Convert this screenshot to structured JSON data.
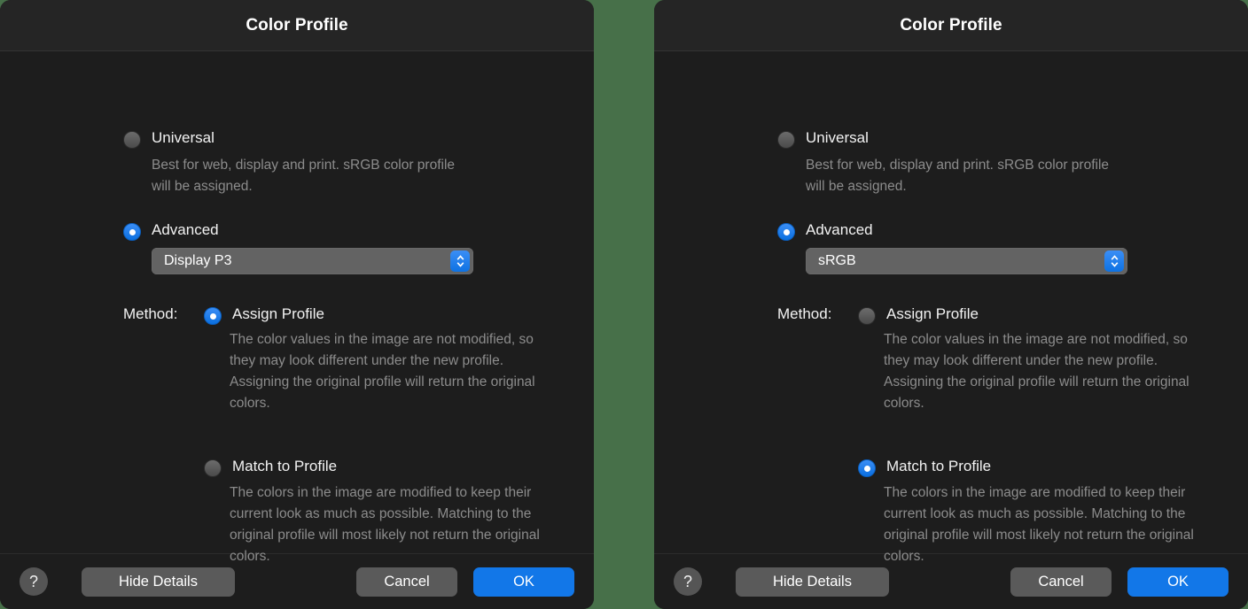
{
  "background_color": "#477049",
  "accent_color": "#1277e8",
  "dialogs": [
    {
      "title": "Color Profile",
      "universal": {
        "label": "Universal",
        "selected": false,
        "description": "Best for web, display and print. sRGB color profile will be assigned."
      },
      "advanced": {
        "label": "Advanced",
        "selected": true,
        "profile_value": "Display P3"
      },
      "method": {
        "label": "Method:",
        "assign": {
          "label": "Assign Profile",
          "selected": true,
          "description": "The color values in the image are not modified, so they may look different under the new profile. Assigning the original profile will return the original colors."
        },
        "match": {
          "label": "Match to Profile",
          "selected": false,
          "description": "The colors in the image are modified to keep their current look as much as possible. Matching to the original profile will most likely not return the original colors."
        }
      },
      "footer": {
        "help_label": "?",
        "hide_details_label": "Hide Details",
        "cancel_label": "Cancel",
        "ok_label": "OK"
      }
    },
    {
      "title": "Color Profile",
      "universal": {
        "label": "Universal",
        "selected": false,
        "description": "Best for web, display and print. sRGB color profile will be assigned."
      },
      "advanced": {
        "label": "Advanced",
        "selected": true,
        "profile_value": "sRGB"
      },
      "method": {
        "label": "Method:",
        "assign": {
          "label": "Assign Profile",
          "selected": false,
          "description": "The color values in the image are not modified, so they may look different under the new profile. Assigning the original profile will return the original colors."
        },
        "match": {
          "label": "Match to Profile",
          "selected": true,
          "description": "The colors in the image are modified to keep their current look as much as possible. Matching to the original profile will most likely not return the original colors."
        }
      },
      "footer": {
        "help_label": "?",
        "hide_details_label": "Hide Details",
        "cancel_label": "Cancel",
        "ok_label": "OK"
      }
    }
  ]
}
